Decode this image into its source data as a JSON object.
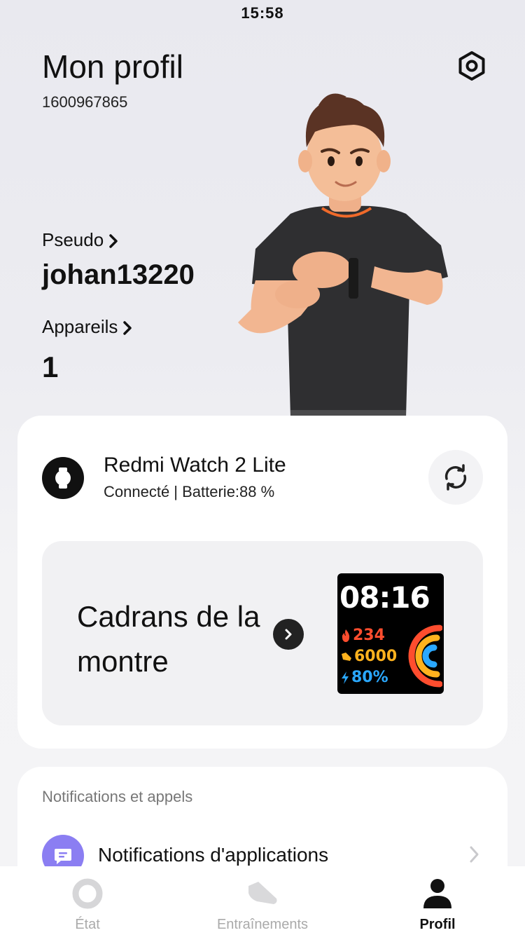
{
  "status_bar": {
    "time": "15:58"
  },
  "header": {
    "title": "Mon profil",
    "user_id": "1600967865"
  },
  "profile": {
    "nickname_label": "Pseudo",
    "nickname_value": "johan13220",
    "devices_label": "Appareils",
    "devices_value": "1"
  },
  "device": {
    "name": "Redmi Watch 2 Lite",
    "status": "Connecté | Batterie:88 %",
    "faces_title": "Cadrans de la montre",
    "preview": {
      "time": "08:16",
      "calories": "234",
      "steps": "6000",
      "battery": "80%"
    }
  },
  "notifications": {
    "section_title": "Notifications et appels",
    "item_label": "Notifications d'applications"
  },
  "tabbar": {
    "tabs": [
      {
        "label": "État",
        "icon": "ring-icon"
      },
      {
        "label": "Entraînements",
        "icon": "shoe-icon"
      },
      {
        "label": "Profil",
        "icon": "person-icon",
        "active": true
      }
    ]
  },
  "colors": {
    "accent_purple": "#8b7ef2",
    "calorie": "#ff4d2e",
    "steps": "#ffb21e",
    "battery": "#2aa8ff"
  }
}
